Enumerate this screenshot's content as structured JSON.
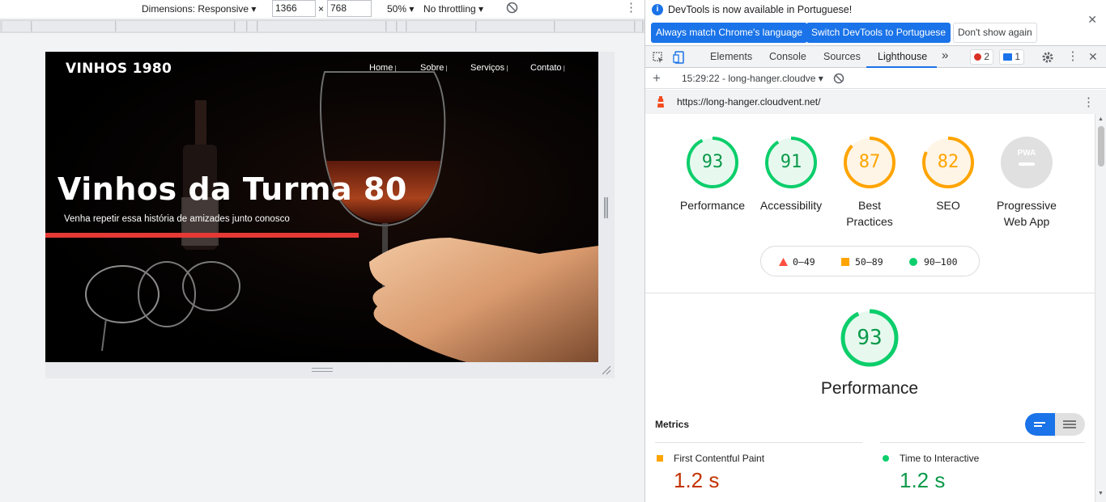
{
  "emulation": {
    "dimensions_label": "Dimensions: Responsive",
    "width_value": "1366",
    "times": "×",
    "height_value": "768",
    "zoom": "50%",
    "throttling": "No throttling"
  },
  "site": {
    "brand": "VINHOS 1980",
    "nav": [
      "Home",
      "Sobre",
      "Serviços",
      "Contato"
    ],
    "hero_title": "Vinhos da Turma 80",
    "hero_subtitle": "Venha repetir essa história de amizades junto conosco"
  },
  "devtools": {
    "infobar": {
      "message": "DevTools is now available in Portuguese!",
      "btn_match": "Always match Chrome's language",
      "btn_switch": "Switch DevTools to Portuguese",
      "btn_dismiss": "Don't show again"
    },
    "tabs": [
      "Elements",
      "Console",
      "Sources",
      "Lighthouse"
    ],
    "active_tab": "Lighthouse",
    "more_tabs": "»",
    "error_count": "2",
    "message_count": "1",
    "run_label": "15:29:22 - long-hanger.cloudve",
    "url": "https://long-hanger.cloudvent.net/"
  },
  "report": {
    "gauges": [
      {
        "score": "93",
        "label": "Performance",
        "status": "pass"
      },
      {
        "score": "91",
        "label": "Accessibility",
        "status": "pass"
      },
      {
        "score": "87",
        "label": "Best Practices",
        "status": "average"
      },
      {
        "score": "82",
        "label": "SEO",
        "status": "average"
      },
      {
        "score": "",
        "label": "Progressive Web App",
        "status": "pwa",
        "badge": "PWA"
      }
    ],
    "legend": {
      "fail": "0–49",
      "average": "50–89",
      "pass": "90–100"
    },
    "perf_score": "93",
    "perf_title": "Performance",
    "metrics_heading": "Metrics",
    "metrics": [
      {
        "name": "First Contentful Paint",
        "value": "1.2 s",
        "status": "average"
      },
      {
        "name": "Time to Interactive",
        "value": "1.2 s",
        "status": "pass"
      }
    ]
  },
  "colors": {
    "pass": "#0cce6b",
    "pass_text": "#0c9a4b",
    "average": "#ffa400",
    "average_text": "#c33300",
    "fail": "#ff4e42",
    "accent": "#1a73e8"
  }
}
